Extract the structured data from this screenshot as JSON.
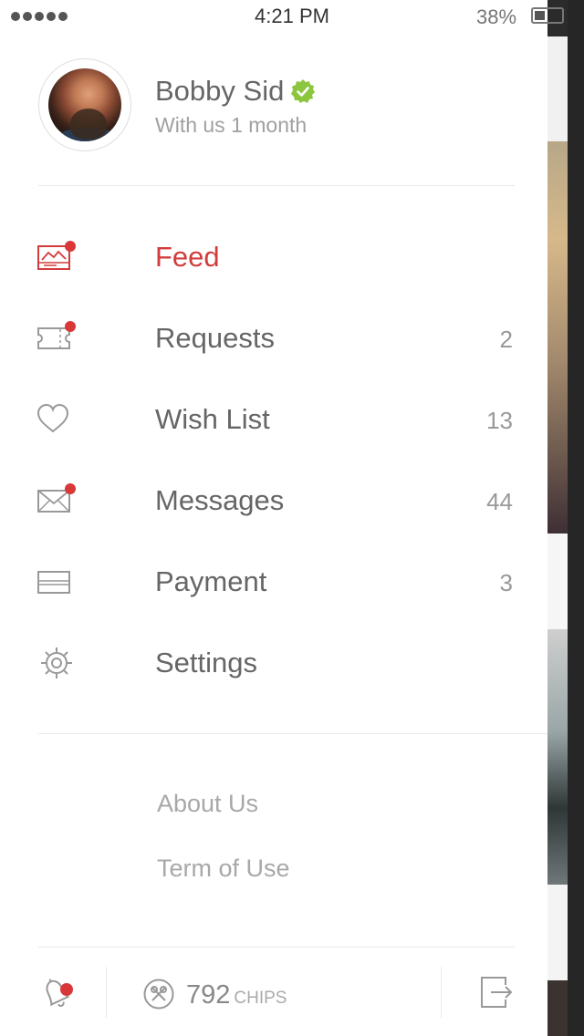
{
  "status_bar": {
    "time": "4:21 PM",
    "battery_percent": "38%",
    "battery_level": 0.38,
    "signal_icon": "signal-dots-icon"
  },
  "profile": {
    "name": "Bobby Sid",
    "membership": "With us 1 month",
    "verified_icon": "verified-badge-icon",
    "verified_color": "#8cc63f"
  },
  "menu": {
    "accent_color": "#d23c3c",
    "items": [
      {
        "label": "Feed",
        "count": "",
        "icon": "feed-icon",
        "active": true,
        "badge": true
      },
      {
        "label": "Requests",
        "count": "2",
        "icon": "ticket-icon",
        "active": false,
        "badge": true
      },
      {
        "label": "Wish List",
        "count": "13",
        "icon": "heart-icon",
        "active": false,
        "badge": false
      },
      {
        "label": "Messages",
        "count": "44",
        "icon": "envelope-icon",
        "active": false,
        "badge": true
      },
      {
        "label": "Payment",
        "count": "3",
        "icon": "credit-card-icon",
        "active": false,
        "badge": false
      },
      {
        "label": "Settings",
        "count": "",
        "icon": "gear-icon",
        "active": false,
        "badge": false
      }
    ]
  },
  "footer_links": [
    {
      "label": "About Us"
    },
    {
      "label": "Term of Use"
    }
  ],
  "bottom_bar": {
    "notifications_icon": "bell-icon",
    "chips_icon": "chips-icon",
    "chips_value": "792",
    "chips_unit": "CHIPS",
    "logout_icon": "logout-icon"
  }
}
